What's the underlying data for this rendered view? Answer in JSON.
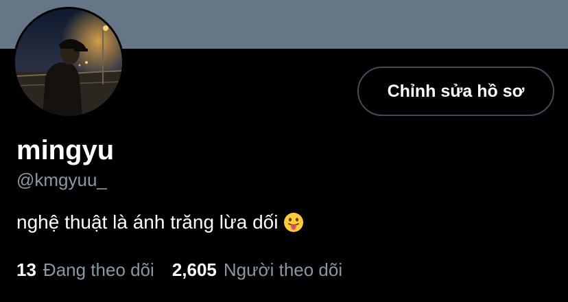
{
  "colors": {
    "background": "#000000",
    "banner": "#657786",
    "primary_text": "#ffffff",
    "secondary_text": "#8899a6",
    "button_border": "#3d4f5e"
  },
  "profile": {
    "avatar_icon": "profile-photo",
    "edit_button_label": "Chỉnh sửa hồ sơ",
    "display_name": "mingyu",
    "handle": "@kmgyuu_",
    "bio_text": "nghệ thuật là ánh trăng lừa dối",
    "bio_emoji": "face-with-tongue"
  },
  "stats": {
    "following_count": "13",
    "following_label": "Đang theo dõi",
    "followers_count": "2,605",
    "followers_label": "Người theo dõi"
  }
}
